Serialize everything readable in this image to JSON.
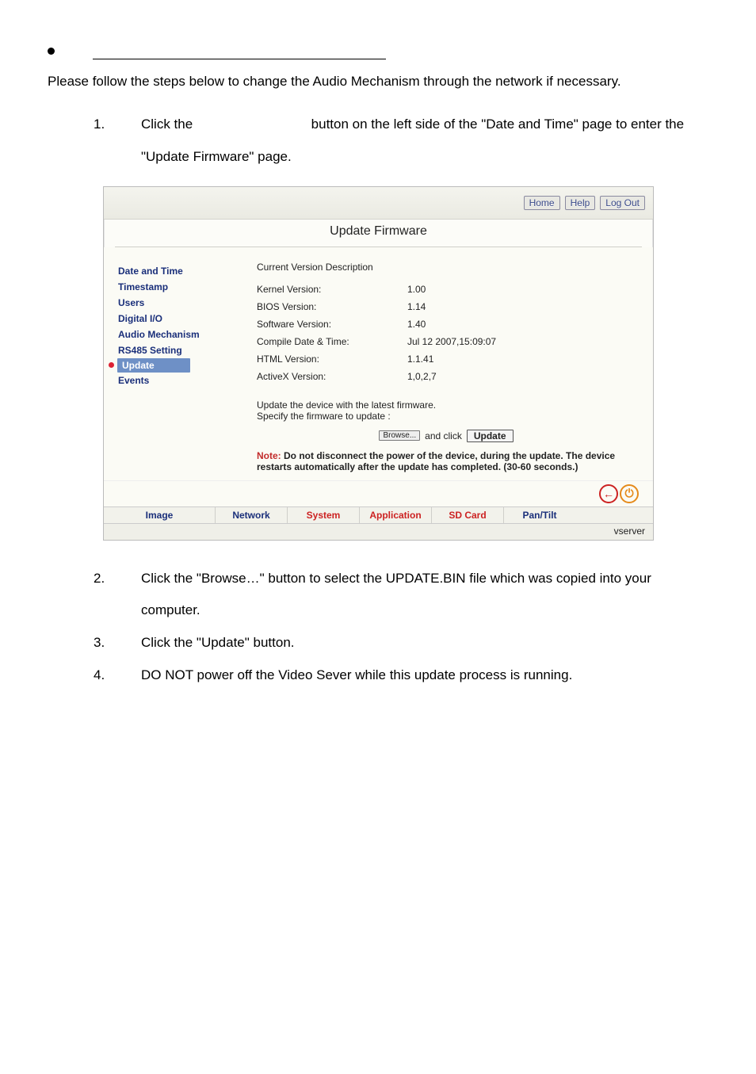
{
  "intro": "Please follow the steps below to change the Audio Mechanism through the network if necessary.",
  "steps": [
    {
      "num": "1.",
      "text_pre": "Click the",
      "text_post": "button on the left side of the \"Date and Time\" page to enter the \"Update Firmware\" page."
    },
    {
      "num": "2.",
      "text": "Click the \"Browse…\" button to select the UPDATE.BIN file which was copied into your computer."
    },
    {
      "num": "3.",
      "text": "Click the \"Update\" button."
    },
    {
      "num": "4.",
      "text": "DO NOT power off the Video Sever while this update process is running."
    }
  ],
  "screenshot": {
    "nav": {
      "home": "Home",
      "help": "Help",
      "logout": "Log Out"
    },
    "title": "Update Firmware",
    "menu": [
      "Date and Time",
      "Timestamp",
      "Users",
      "Digital I/O",
      "Audio Mechanism",
      "RS485 Setting",
      "Update",
      "Events"
    ],
    "section_label": "Current Version Description",
    "rows": [
      {
        "k": "Kernel Version:",
        "v": "1.00"
      },
      {
        "k": "BIOS Version:",
        "v": "1.14"
      },
      {
        "k": "Software Version:",
        "v": "1.40"
      },
      {
        "k": "Compile Date & Time:",
        "v": "Jul 12 2007,15:09:07"
      },
      {
        "k": "HTML Version:",
        "v": "1.1.41"
      },
      {
        "k": "ActiveX Version:",
        "v": "1,0,2,7"
      }
    ],
    "update_line1": "Update the device with the latest firmware.",
    "update_line2": "Specify the firmware to update :",
    "browse_btn": "Browse...",
    "and_click": "and click",
    "update_btn": "Update",
    "note_label": "Note:",
    "note_text": " Do not disconnect the power of the device, during the update. The device restarts automatically after the update has completed. (30-60 seconds.)",
    "tabs": {
      "image": "Image",
      "network": "Network",
      "system": "System",
      "application": "Application",
      "sd": "SD Card",
      "pan": "Pan/Tilt"
    },
    "footer": "vserver"
  }
}
